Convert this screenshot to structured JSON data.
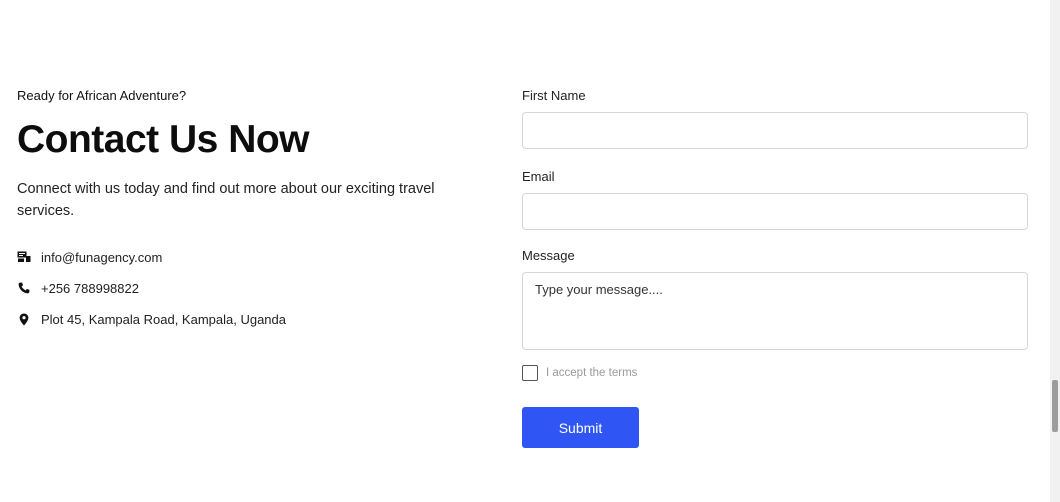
{
  "contact_section": {
    "eyebrow": "Ready for African Adventure?",
    "title": "Contact Us Now",
    "description": "Connect with us today and find out more about our exciting travel services.",
    "contacts": [
      {
        "icon": "mail-icon",
        "text": "info@funagency.com"
      },
      {
        "icon": "phone-icon",
        "text": "+256 788998822"
      },
      {
        "icon": "location-pin-icon",
        "text": "Plot 45, Kampala Road, Kampala, Uganda"
      }
    ]
  },
  "form": {
    "first_name": {
      "label": "First Name",
      "value": "",
      "placeholder": ""
    },
    "email": {
      "label": "Email",
      "value": "",
      "placeholder": ""
    },
    "message": {
      "label": "Message",
      "value": "",
      "placeholder": "Type your message...."
    },
    "terms_label": "I accept the terms",
    "terms_checked": false,
    "submit_label": "Submit"
  },
  "colors": {
    "accent": "#2f56f5",
    "text": "#1a1a1a",
    "muted": "#9a9a9a",
    "border": "#d6d6d6"
  }
}
